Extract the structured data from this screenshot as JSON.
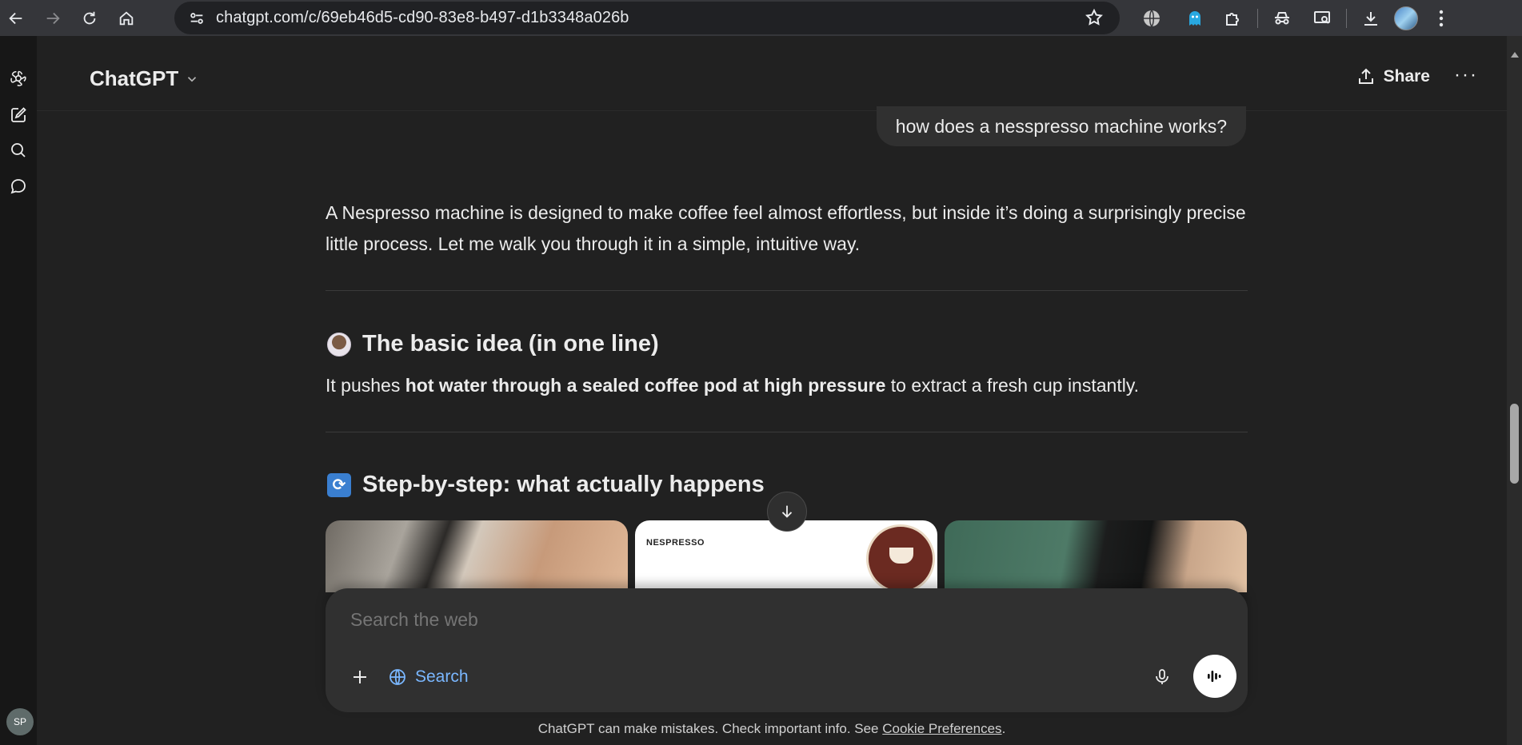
{
  "browser": {
    "url": "chatgpt.com/c/69eb46d5-cd90-83e8-b497-d1b3348a026b",
    "nav": [
      "back-icon",
      "forward-icon",
      "reload-icon",
      "home-icon"
    ],
    "extensions": [
      "globe-icon",
      "ghost-icon",
      "puzzle-icon",
      "incognito-icon",
      "screen-search-icon",
      "download-icon",
      "profile-avatar",
      "menu-dots-icon"
    ]
  },
  "sidebar": {
    "items": [
      "openai-logo-icon",
      "new-chat-icon",
      "search-icon",
      "chat-icon"
    ],
    "avatar_initials": "SP"
  },
  "header": {
    "title": "ChatGPT",
    "share_label": "Share",
    "more_label": "···"
  },
  "conversation": {
    "user_message": "how does a nesspresso machine works?",
    "intro": "A Nespresso machine is designed to make coffee feel almost effortless, but inside it’s doing a surprisingly precise little process. Let me walk you through it in a simple, intuitive way.",
    "heading1": "The basic idea (in one line)",
    "basic_before": "It pushes ",
    "basic_bold": "hot water through a sealed coffee pod at high pressure",
    "basic_after": " to extract a fresh cup instantly.",
    "heading2": "Step-by-step: what actually happens",
    "image2_brand": "NESPRESSO"
  },
  "composer": {
    "placeholder": "Search the web",
    "search_label": "Search"
  },
  "footer": {
    "disclaimer": "ChatGPT can make mistakes. Check important info. See ",
    "link": "Cookie Preferences",
    "end": "."
  },
  "colors": {
    "background": "#212121",
    "composer": "#303030",
    "search_accent": "#7ab7ff",
    "browser_bar": "#35363a"
  }
}
